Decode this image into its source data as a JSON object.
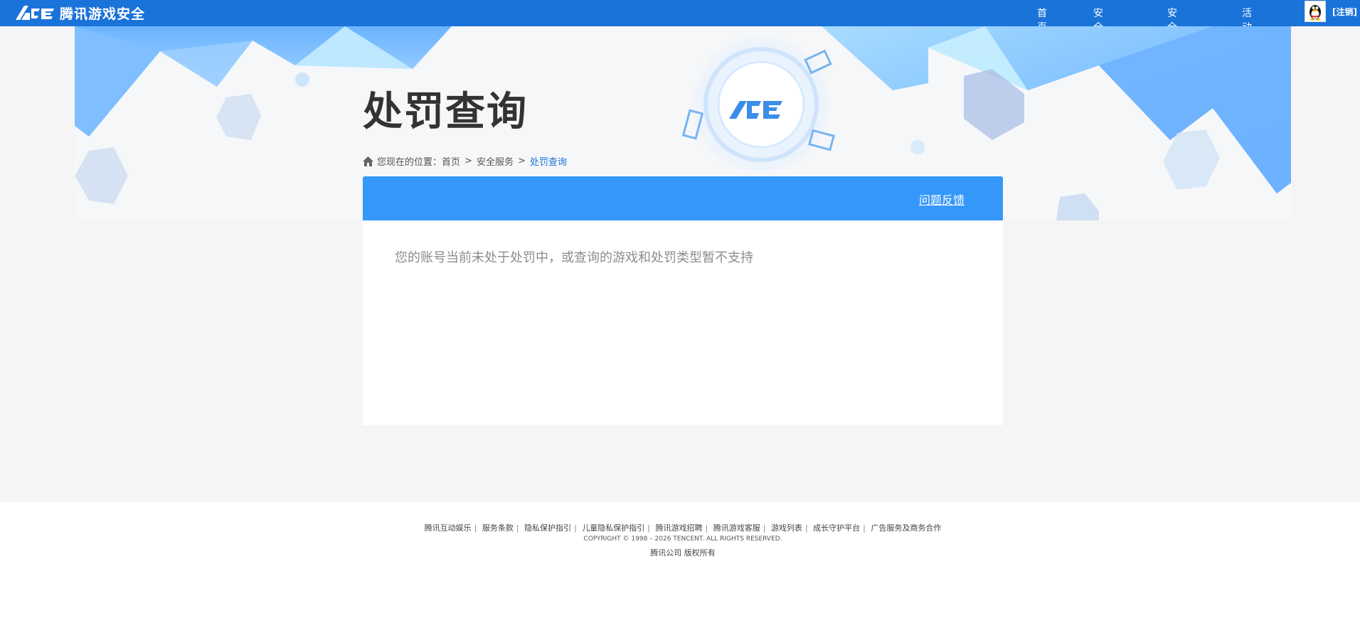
{
  "header": {
    "logo_text": "腾讯游戏安全",
    "nav": [
      "首页",
      "安全服务",
      "安全学院",
      "活动专区"
    ],
    "logout_label": "[注销]"
  },
  "banner": {
    "title": "处罚查询"
  },
  "breadcrumb": {
    "prefix": "您现在的位置：",
    "items": [
      "首页",
      "安全服务",
      "处罚查询"
    ],
    "separator": ">"
  },
  "panel": {
    "feedback_label": "问题反馈",
    "notice": "您的账号当前未处于处罚中，或查询的游戏和处罚类型暂不支持"
  },
  "footer": {
    "links": [
      "腾讯互动娱乐",
      "服务条款",
      "隐私保护指引",
      "儿童隐私保护指引",
      "腾讯游戏招聘",
      "腾讯游戏客服",
      "游戏列表",
      "成长守护平台",
      "广告服务及商务合作"
    ],
    "copyright": "COPYRIGHT © 1998 – 2026 TENCENT. ALL RIGHTS RESERVED.",
    "company": "腾讯公司 版权所有"
  },
  "colors": {
    "topbar": "#1a73d9",
    "panel_header": "#3597f9",
    "breadcrumb_current": "#1a73d9"
  }
}
